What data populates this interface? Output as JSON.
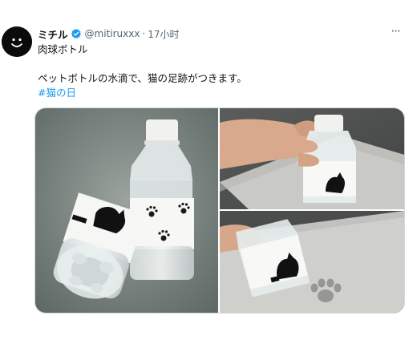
{
  "tweet": {
    "display_name": "ミチル",
    "handle": "@mitiruxxx",
    "separator": "·",
    "time": "17小时",
    "more_label": "···",
    "text_line1": "肉球ボトル",
    "text_line2": "ペットボトルの水滴で、猫の足跡がつきます。",
    "hashtag": "#猫の日"
  },
  "colors": {
    "accent": "#1d9bf0",
    "secondary_text": "#536471",
    "border": "#cfd9de"
  },
  "icons": {
    "verified": "verified-badge-icon",
    "more": "more-horizontal-icon"
  }
}
